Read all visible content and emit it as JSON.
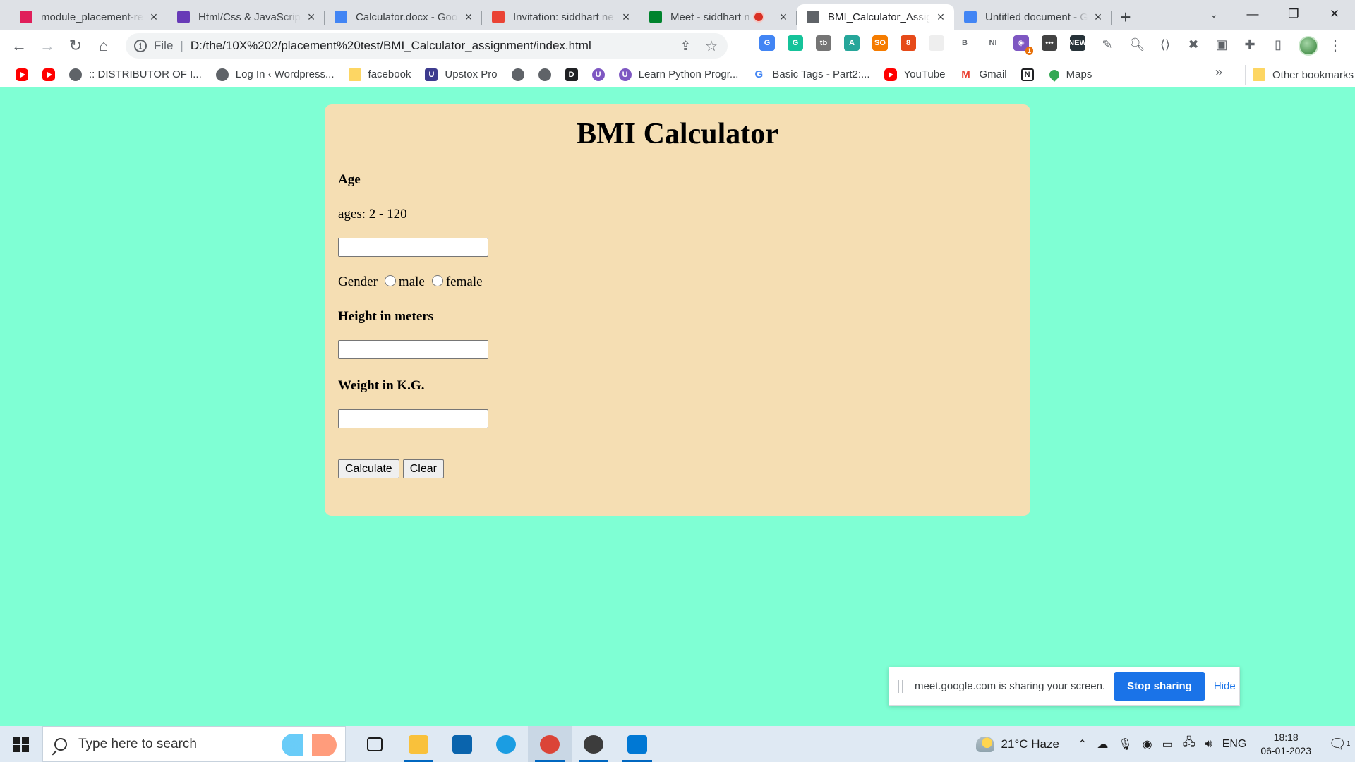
{
  "browser": {
    "tabs": [
      {
        "title": "module_placement-re",
        "icon": "slack-icon",
        "color": "#e01e5a",
        "active": false,
        "recording": false
      },
      {
        "title": "Html/Css & JavaScript",
        "icon": "forms-icon",
        "color": "#673ab7",
        "active": false,
        "recording": false
      },
      {
        "title": "Calculator.docx - Goo",
        "icon": "docs-icon",
        "color": "#4285f4",
        "active": false,
        "recording": false
      },
      {
        "title": "Invitation: siddhart ne",
        "icon": "gmail-icon",
        "color": "#ea4335",
        "active": false,
        "recording": false
      },
      {
        "title": "Meet - siddhart n",
        "icon": "meet-icon",
        "color": "#00832d",
        "active": false,
        "recording": true
      },
      {
        "title": "BMI_Calculator_Assig",
        "icon": "globe-icon",
        "color": "#5f6368",
        "active": true,
        "recording": false
      },
      {
        "title": "Untitled document - G",
        "icon": "docs-icon",
        "color": "#4285f4",
        "active": false,
        "recording": false
      }
    ],
    "address": {
      "scheme": "File",
      "url": "D:/the/10X%202/placement%20test/BMI_Calculator_assignment/index.html"
    },
    "extensions": [
      {
        "name": "translate-icon",
        "color": "#4285f4",
        "glyph": "G"
      },
      {
        "name": "grammarly-icon",
        "color": "#15c39a",
        "glyph": "G"
      },
      {
        "name": "tb-icon",
        "color": "#757575",
        "glyph": "tb"
      },
      {
        "name": "drive-icon",
        "color": "#26a69a",
        "glyph": "A"
      },
      {
        "name": "so-icon",
        "color": "#f57c00",
        "glyph": "SO"
      },
      {
        "name": "lock-ext-icon",
        "color": "#e64a19",
        "glyph": "8"
      },
      {
        "name": "blank-ext-icon",
        "color": "#eeeeee",
        "glyph": ""
      },
      {
        "name": "b-ext-icon",
        "color": "#ffffff",
        "glyph": "B"
      },
      {
        "name": "ni-ext-icon",
        "color": "#ffffff",
        "glyph": "NI"
      },
      {
        "name": "ai-ext-icon",
        "color": "#7e57c2",
        "glyph": "✳"
      },
      {
        "name": "dots-ext-icon",
        "color": "#424242",
        "glyph": "•••"
      },
      {
        "name": "new-ext-icon",
        "color": "#263238",
        "glyph": "NEW"
      }
    ],
    "extension_badge": "1",
    "bookmarks": [
      {
        "label": "",
        "icon": "youtube-icon",
        "kind": "yt"
      },
      {
        "label": "",
        "icon": "youtube-icon",
        "kind": "yt"
      },
      {
        "label": ":: DISTRIBUTOR OF I...",
        "icon": "globe-icon",
        "kind": "globe"
      },
      {
        "label": "Log In ‹ Wordpress...",
        "icon": "globe-icon",
        "kind": "globe"
      },
      {
        "label": "facebook",
        "icon": "folder-icon",
        "kind": "folder"
      },
      {
        "label": "Upstox Pro",
        "icon": "upstox-icon",
        "kind": "upstox"
      },
      {
        "label": "",
        "icon": "globe-icon",
        "kind": "globe"
      },
      {
        "label": "",
        "icon": "globe-icon",
        "kind": "globe"
      },
      {
        "label": "",
        "icon": "d-logo-icon",
        "kind": "dark"
      },
      {
        "label": "",
        "icon": "u-logo-icon",
        "kind": "purple"
      },
      {
        "label": "Learn Python Progr...",
        "icon": "u-logo-icon",
        "kind": "purple"
      },
      {
        "label": "Basic Tags - Part2:...",
        "icon": "g-logo-icon",
        "kind": "g"
      },
      {
        "label": "YouTube",
        "icon": "youtube-icon",
        "kind": "yt"
      },
      {
        "label": "Gmail",
        "icon": "gmail-icon",
        "kind": "gmail"
      },
      {
        "label": "",
        "icon": "notion-icon",
        "kind": "notion"
      },
      {
        "label": "Maps",
        "icon": "maps-icon",
        "kind": "maps"
      }
    ],
    "bookmarks_more": "»",
    "other_bookmarks": "Other bookmarks"
  },
  "page": {
    "background": "#7fffd4",
    "card_color": "#f5deb3",
    "title": "BMI Calculator",
    "age_label": "Age",
    "age_hint": "ages: 2 - 120",
    "age_value": "",
    "gender_label": "Gender",
    "gender_options": [
      "male",
      "female"
    ],
    "height_label": "Height in meters",
    "height_value": "",
    "weight_label": "Weight in K.G.",
    "weight_value": "",
    "calculate_button": "Calculate",
    "clear_button": "Clear"
  },
  "share_bar": {
    "message": "meet.google.com is sharing your screen.",
    "stop_button": "Stop sharing",
    "hide_link": "Hide",
    "accent": "#1a73e8"
  },
  "taskbar": {
    "search_placeholder": "Type here to search",
    "apps": [
      {
        "name": "task-view-icon",
        "color": "#1c1c1c",
        "running": false,
        "active": false
      },
      {
        "name": "file-explorer-icon",
        "color": "#f9c13b",
        "running": true,
        "active": false
      },
      {
        "name": "mail-icon",
        "color": "#0a64ad",
        "running": false,
        "active": false
      },
      {
        "name": "edge-icon",
        "color": "#1b9de2",
        "running": false,
        "active": false
      },
      {
        "name": "chrome-icon",
        "color": "#db4437",
        "running": true,
        "active": true
      },
      {
        "name": "settings-icon",
        "color": "#3c3c3c",
        "running": true,
        "active": false
      },
      {
        "name": "vscode-icon",
        "color": "#0078d4",
        "running": true,
        "active": false
      }
    ],
    "weather": "21°C  Haze",
    "language": "ENG",
    "time": "18:18",
    "date": "06-01-2023",
    "notification_count": "1"
  }
}
